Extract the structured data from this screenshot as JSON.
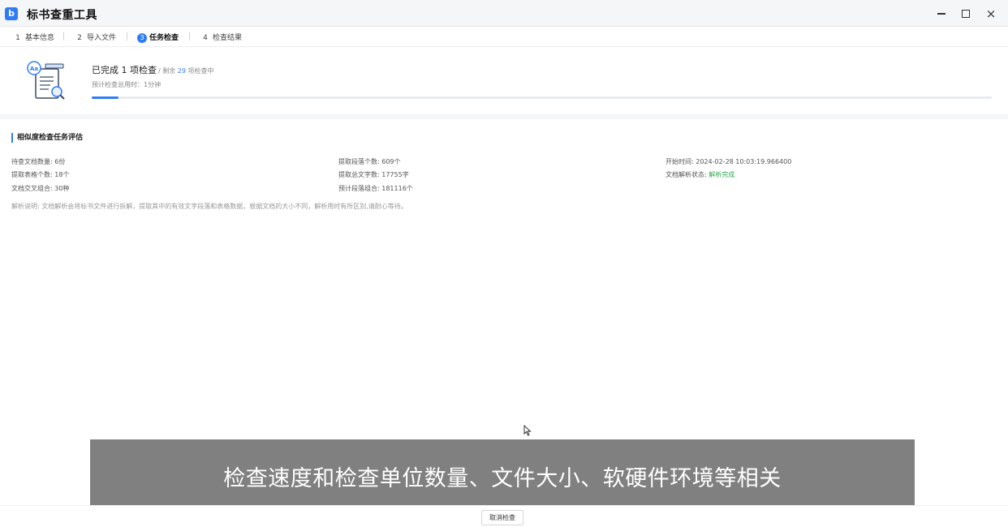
{
  "app": {
    "icon_glyph": "b",
    "title": "标书查重工具"
  },
  "window_controls": {
    "minimize": "minimize-icon",
    "maximize": "maximize-icon",
    "close": "×"
  },
  "steps": [
    {
      "num": "1",
      "label": "基本信息",
      "active": false
    },
    {
      "num": "2",
      "label": "导入文件",
      "active": false
    },
    {
      "num": "3",
      "label": "任务检查",
      "active": true
    },
    {
      "num": "4",
      "label": "检查结果",
      "active": false
    }
  ],
  "progress": {
    "title": "已完成 1 项检查",
    "remaining_prefix": "/ 剩余",
    "remaining_count": "29",
    "remaining_suffix": "项检查中",
    "estimate": "预计检查总用时：1分钟",
    "fraction": 0.03
  },
  "section": {
    "title": "相似度检查任务评估"
  },
  "info": {
    "col1": [
      {
        "label": "待查文档数量:",
        "value": "6份"
      },
      {
        "label": "提取表格个数:",
        "value": "18个"
      },
      {
        "label": "文档交叉组合:",
        "value": "30种"
      }
    ],
    "col2": [
      {
        "label": "提取段落个数:",
        "value": "609个"
      },
      {
        "label": "提取总文字数:",
        "value": "17755字"
      },
      {
        "label": "预计段落组合:",
        "value": "181116个"
      }
    ],
    "col3": [
      {
        "label": "开始时间:",
        "value": "2024-02-28 10:03:19.966400"
      },
      {
        "label": "文档解析状态:",
        "value": "解析完成"
      }
    ]
  },
  "note": "解析说明: 文档解析会将标书文件进行拆解，提取其中的有效文字段落和表格数据，根据文档的大小不同，解析用时有所区别,请耐心等待。",
  "caption": "检查速度和检查单位数量、文件大小、软硬件环境等相关",
  "footer": {
    "cancel_label": "取消检查"
  },
  "colors": {
    "accent": "#2f7cf6",
    "success": "#35a853"
  }
}
